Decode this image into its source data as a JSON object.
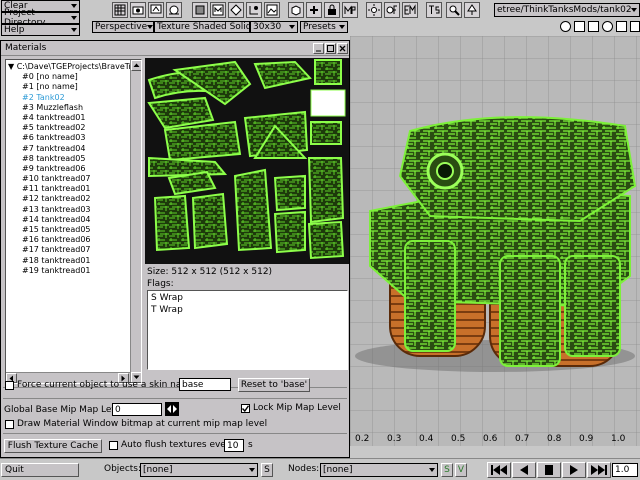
{
  "left_menu": [
    "Clear",
    "Project Directory",
    "Help"
  ],
  "toolbar": {
    "button_labels": [
      "",
      "",
      "",
      "",
      "",
      "",
      "",
      "",
      "",
      "",
      "",
      "",
      "",
      "",
      "",
      "",
      ""
    ],
    "icons": [
      "grid-icon",
      "camera-icon",
      "screen-icon",
      "sphere-icon",
      "model-icon",
      "cm-icon",
      "ls-icon",
      "image-icon",
      "cube-icon",
      "plus-icon",
      "lock-icon",
      "mp-icon",
      "sun-icon",
      "of-icon",
      "em-icon",
      "ts-icon",
      "paint-icon",
      "tree-icon"
    ],
    "path_value": "etree/ThinkTanksMods/tank02.dts"
  },
  "viewbar": {
    "view": "Perspective",
    "render_mode": "Texture Shaded Solid",
    "grid": "30x30",
    "presets": "Presets"
  },
  "materials_window": {
    "title": "Materials",
    "tree_root": "C:\\Dave\\TGEProjects\\BraveTr",
    "items": [
      "#0 [no name]",
      "#1 [no name]",
      "#2 Tank02",
      "#3 Muzzleflash",
      "#4 tanktread01",
      "#5 tanktread02",
      "#6 tanktread03",
      "#7 tanktread04",
      "#8 tanktread05",
      "#9 tanktread06",
      "#10 tanktread07",
      "#11 tanktread01",
      "#12 tanktread02",
      "#13 tanktread03",
      "#14 tanktread04",
      "#15 tanktread05",
      "#16 tanktread06",
      "#17 tanktread07",
      "#18 tanktread01",
      "#19 tanktread01"
    ],
    "selected_index": 2,
    "size_text": "Size: 512 x 512 (512 x 512)",
    "flags_label": "Flags:",
    "flags": [
      "S Wrap",
      "T Wrap"
    ],
    "force_skin_label": "Force current object to use a skin named:",
    "skin_value": "base",
    "reset_button": "Reset to 'base'",
    "mip_label": "Global Base Mip Map Level:",
    "mip_value": "0",
    "lock_mip_label": "Lock Mip Map Level",
    "draw_bitmap_label": "Draw Material Window bitmap at current mip map level",
    "flush_button": "Flush Texture Cache",
    "auto_flush_label": "Auto flush textures every",
    "auto_flush_value": "10",
    "auto_flush_unit": "s"
  },
  "timeline": {
    "ticks": [
      "0.2",
      "0.3",
      "0.4",
      "0.5",
      "0.6",
      "0.7",
      "0.8",
      "0.9",
      "1.0"
    ],
    "value": "1.0"
  },
  "bottom_bar": {
    "quit": "Quit",
    "objects_label": "Objects:",
    "objects_value": "[none]",
    "objects_btn": "S",
    "nodes_label": "Nodes:",
    "nodes_value": "[none]",
    "nodes_btn_s": "S",
    "nodes_btn_v": "V",
    "frame_value": "1.0"
  },
  "colors": {
    "panel": "#c6c3c6",
    "selected_item": "#2e9bd6",
    "tank_green": "#6fd12c",
    "tread_orange": "#c8702a"
  }
}
